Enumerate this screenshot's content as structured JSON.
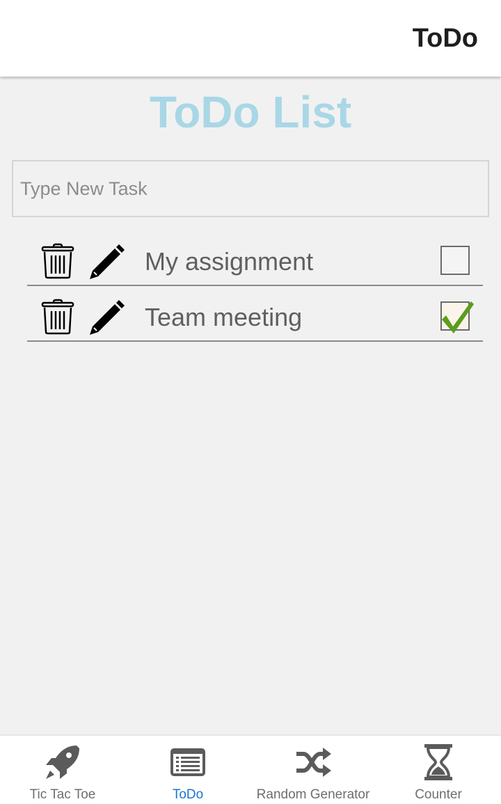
{
  "header": {
    "title": "ToDo"
  },
  "page": {
    "title": "ToDo List"
  },
  "new_task": {
    "placeholder": "Type New Task",
    "value": ""
  },
  "tasks": [
    {
      "label": "My assignment",
      "checked": false
    },
    {
      "label": "Team meeting",
      "checked": true
    }
  ],
  "icons": {
    "row": [
      "trash-icon",
      "pencil-icon"
    ],
    "nav": [
      "rocket-icon",
      "list-icon",
      "shuffle-icon",
      "hourglass-icon"
    ]
  },
  "bottom_nav": {
    "items": [
      {
        "label": "Tic Tac Toe",
        "active": false
      },
      {
        "label": "ToDo",
        "active": true
      },
      {
        "label": "Random Generator",
        "active": false
      },
      {
        "label": "Counter",
        "active": false
      }
    ]
  },
  "colors": {
    "title": "#a9d7e6",
    "active_tab": "#1976d2",
    "checkmark": "#5a9e1b",
    "background": "#f1f1f1"
  }
}
